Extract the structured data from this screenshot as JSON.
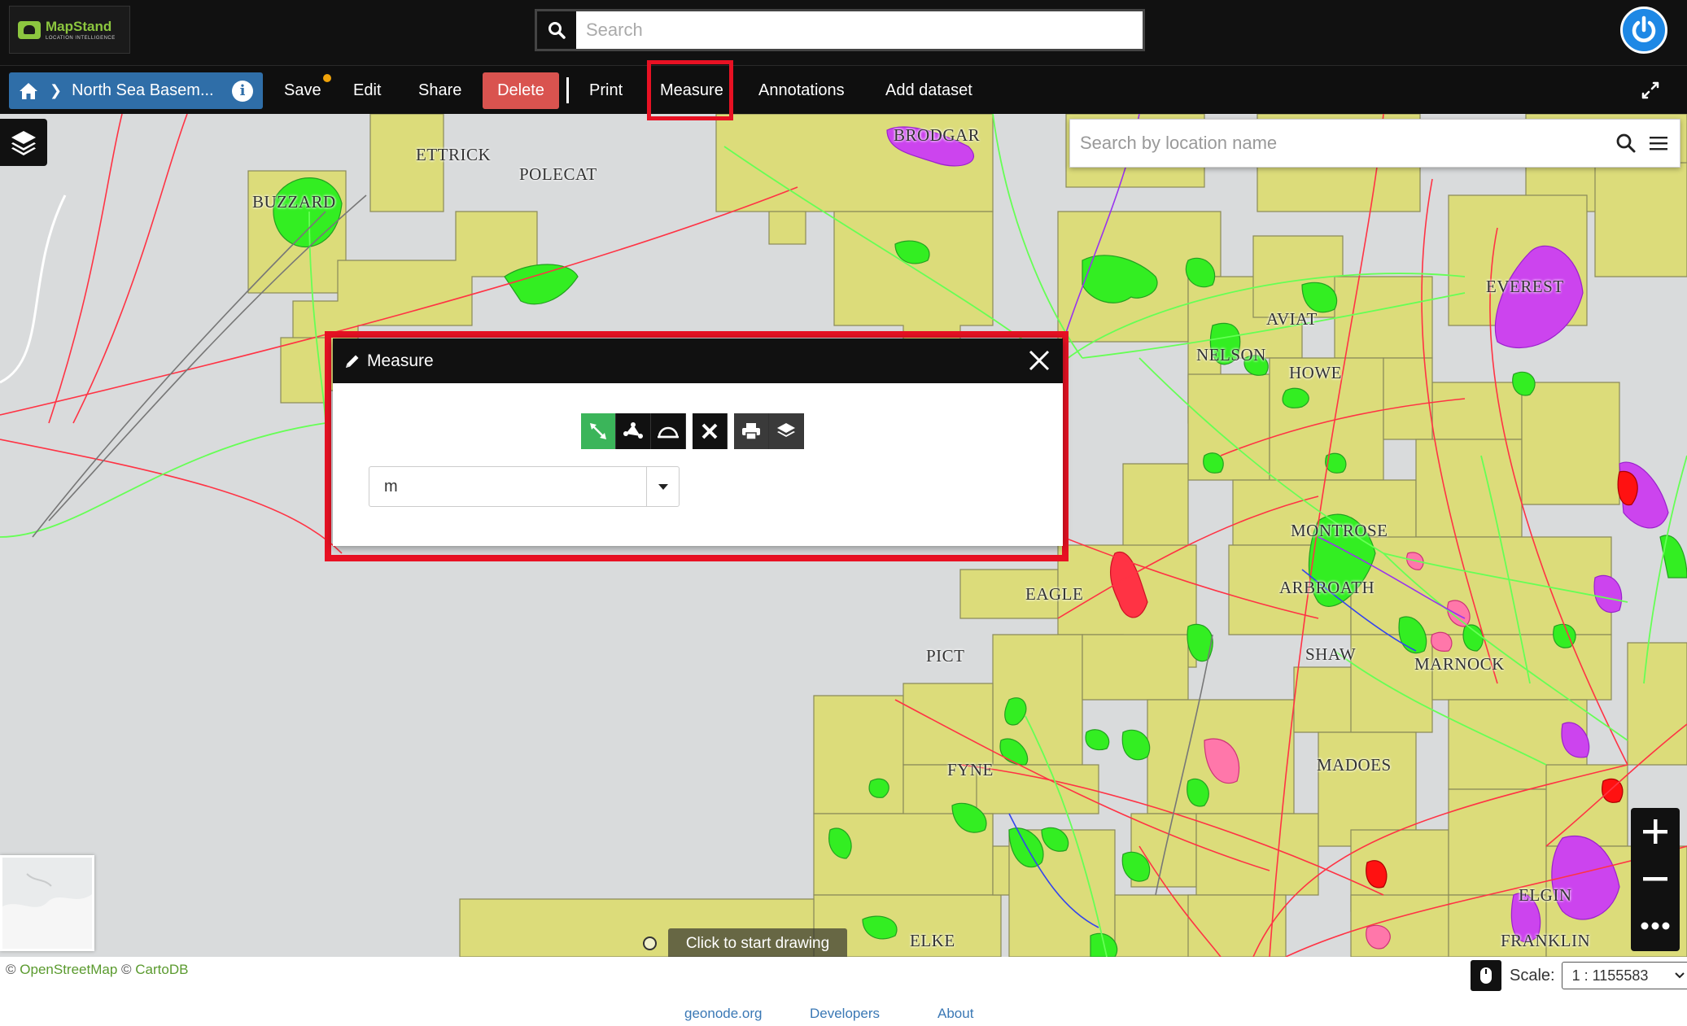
{
  "header": {
    "logo_name": "MapStand",
    "logo_tagline": "LOCATION INTELLIGENCE",
    "search_placeholder": "Search"
  },
  "menubar": {
    "map_title": "North Sea Basem...",
    "items": {
      "save": "Save",
      "edit": "Edit",
      "share": "Share",
      "delete": "Delete",
      "print": "Print",
      "measure": "Measure",
      "annotations": "Annotations",
      "add_dataset": "Add dataset"
    }
  },
  "map": {
    "location_search_placeholder": "Search by location name",
    "draw_hint": "Click to start drawing",
    "labels": {
      "ettrick": "ETTRICK",
      "polecat": "POLECAT",
      "buzzard": "BUZZARD",
      "brodgar": "BRODGAR",
      "everest": "EVEREST",
      "aviat": "AVIAT",
      "nelson": "NELSON",
      "howe": "HOWE",
      "montrose": "MONTROSE",
      "arbroath": "ARBROATH",
      "eagle": "EAGLE",
      "shaw": "SHAW",
      "pict": "PICT",
      "marnock": "MARNOCK",
      "madoes": "MADOES",
      "fyne": "FYNE",
      "elgin": "ELGIN",
      "elke": "ELKE",
      "franklin": "FRANKLIN"
    }
  },
  "measure_dialog": {
    "title": "Measure",
    "unit": "m",
    "tools": [
      "measure-length",
      "measure-area",
      "measure-bearing",
      "clear",
      "print",
      "export-layer"
    ]
  },
  "footer": {
    "attribution_prefix": "©",
    "osm": "OpenStreetMap",
    "attribution_mid": "©",
    "cartodb": "CartoDB",
    "links": [
      "geonode.org",
      "Developers",
      "About"
    ],
    "scale_label": "Scale:",
    "scale_value": "1 : 1155583"
  },
  "colors": {
    "accent_blue": "#2f6ea8",
    "delete_red": "#d9534f",
    "highlight_red": "#e81123",
    "active_tool_green": "#3bb55a",
    "license_yellow": "#dcdc7a",
    "field_green": "#33ee22",
    "field_magenta": "#cc44ee",
    "pipeline_red": "#ff3344"
  }
}
